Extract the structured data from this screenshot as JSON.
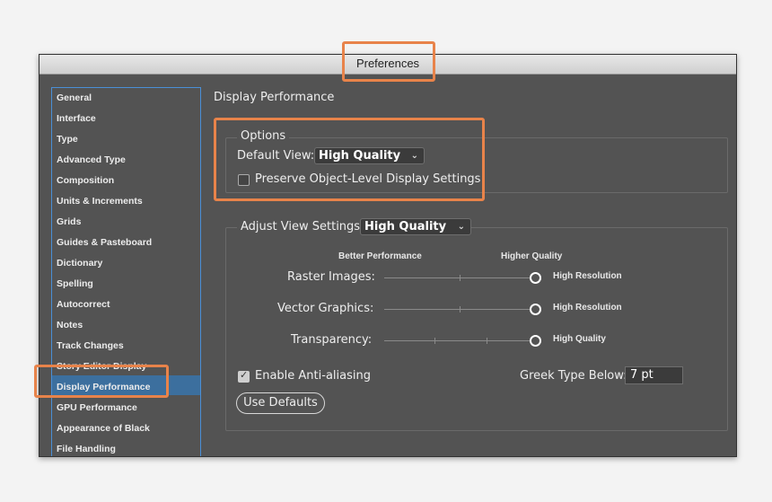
{
  "window": {
    "title": "Preferences"
  },
  "sidebar": {
    "items": [
      {
        "label": "General"
      },
      {
        "label": "Interface"
      },
      {
        "label": "Type"
      },
      {
        "label": "Advanced Type"
      },
      {
        "label": "Composition"
      },
      {
        "label": "Units & Increments"
      },
      {
        "label": "Grids"
      },
      {
        "label": "Guides & Pasteboard"
      },
      {
        "label": "Dictionary"
      },
      {
        "label": "Spelling"
      },
      {
        "label": "Autocorrect"
      },
      {
        "label": "Notes"
      },
      {
        "label": "Track Changes"
      },
      {
        "label": "Story Editor Display"
      },
      {
        "label": "Display Performance"
      },
      {
        "label": "GPU Performance"
      },
      {
        "label": "Appearance of Black"
      },
      {
        "label": "File Handling"
      }
    ],
    "selected": "Display Performance"
  },
  "main": {
    "section_title": "Display Performance",
    "options": {
      "legend": "Options",
      "default_view_label": "Default View:",
      "default_view_value": "High Quality",
      "preserve_label": "Preserve Object-Level Display Settings",
      "preserve_checked": false
    },
    "adjust": {
      "label": "Adjust View Settings:",
      "value": "High Quality",
      "better_performance": "Better Performance",
      "higher_quality": "Higher Quality",
      "sliders": [
        {
          "label": "Raster Images:",
          "value_label": "High Resolution",
          "level": 1.0
        },
        {
          "label": "Vector Graphics:",
          "value_label": "High Resolution",
          "level": 1.0
        },
        {
          "label": "Transparency:",
          "value_label": "High Quality",
          "level": 1.0
        }
      ],
      "antialias_label": "Enable Anti-aliasing",
      "antialias_checked": true,
      "greek_label": "Greek Type Below:",
      "greek_value": "7 pt",
      "use_defaults": "Use Defaults"
    }
  },
  "highlight_color": "#e8834a",
  "selection_color": "#3c6f9e"
}
